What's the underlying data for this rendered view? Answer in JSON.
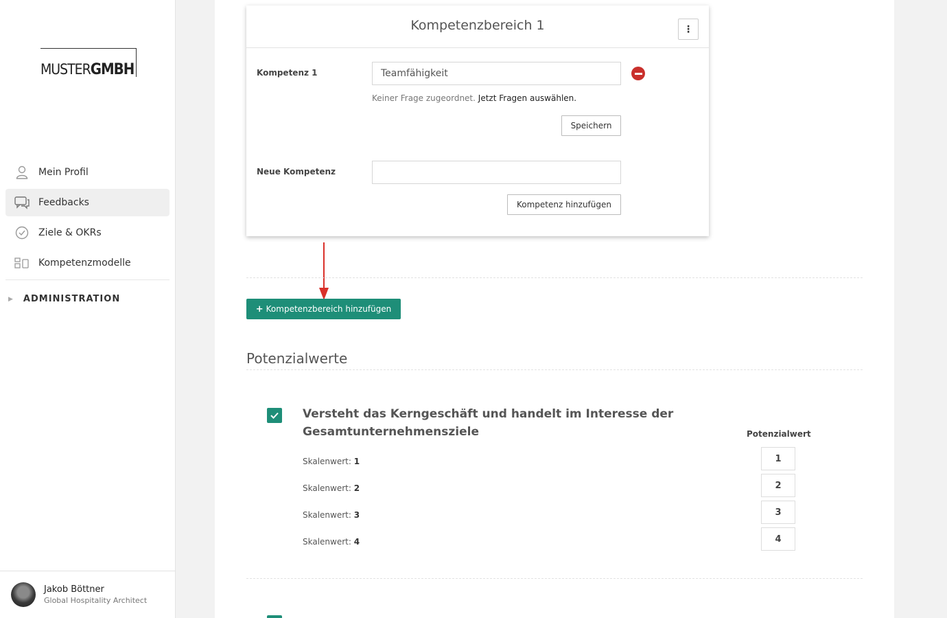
{
  "logo": {
    "part1": "MUSTER",
    "part2": "GMBH"
  },
  "sidebar": {
    "items": [
      {
        "label": "Mein Profil",
        "icon": "user-icon"
      },
      {
        "label": "Feedbacks",
        "icon": "chat-icon"
      },
      {
        "label": "Ziele & OKRs",
        "icon": "check-circle-icon"
      },
      {
        "label": "Kompetenzmodelle",
        "icon": "modules-icon"
      }
    ],
    "admin_label": "ADMINISTRATION"
  },
  "user": {
    "name": "Jakob Böttner",
    "role": "Global Hospitality Architect"
  },
  "card": {
    "title": "Kompetenzbereich 1",
    "kompetenz_label": "Kompetenz 1",
    "kompetenz_value": "Teamfähigkeit",
    "hint_text": "Keiner Frage zugeordnet.",
    "hint_link": "Jetzt Fragen auswählen.",
    "save_label": "Speichern",
    "new_label": "Neue Kompetenz",
    "new_value": "",
    "add_label": "Kompetenz hinzufügen"
  },
  "add_area_label": "Kompetenzbereich hinzufügen",
  "potential": {
    "section_title": "Potenzialwerte",
    "question": "Versteht das Kerngeschäft und handelt im Interesse der Gesamtunternehmensziele",
    "scale_prefix": "Skalenwert:",
    "scale_values": [
      "1",
      "2",
      "3",
      "4"
    ],
    "column_header": "Potenzialwert",
    "boxes": [
      "1",
      "2",
      "3",
      "4"
    ]
  },
  "colors": {
    "accent": "#1e8e78",
    "danger": "#c9302c",
    "arrow": "#d9302a"
  }
}
